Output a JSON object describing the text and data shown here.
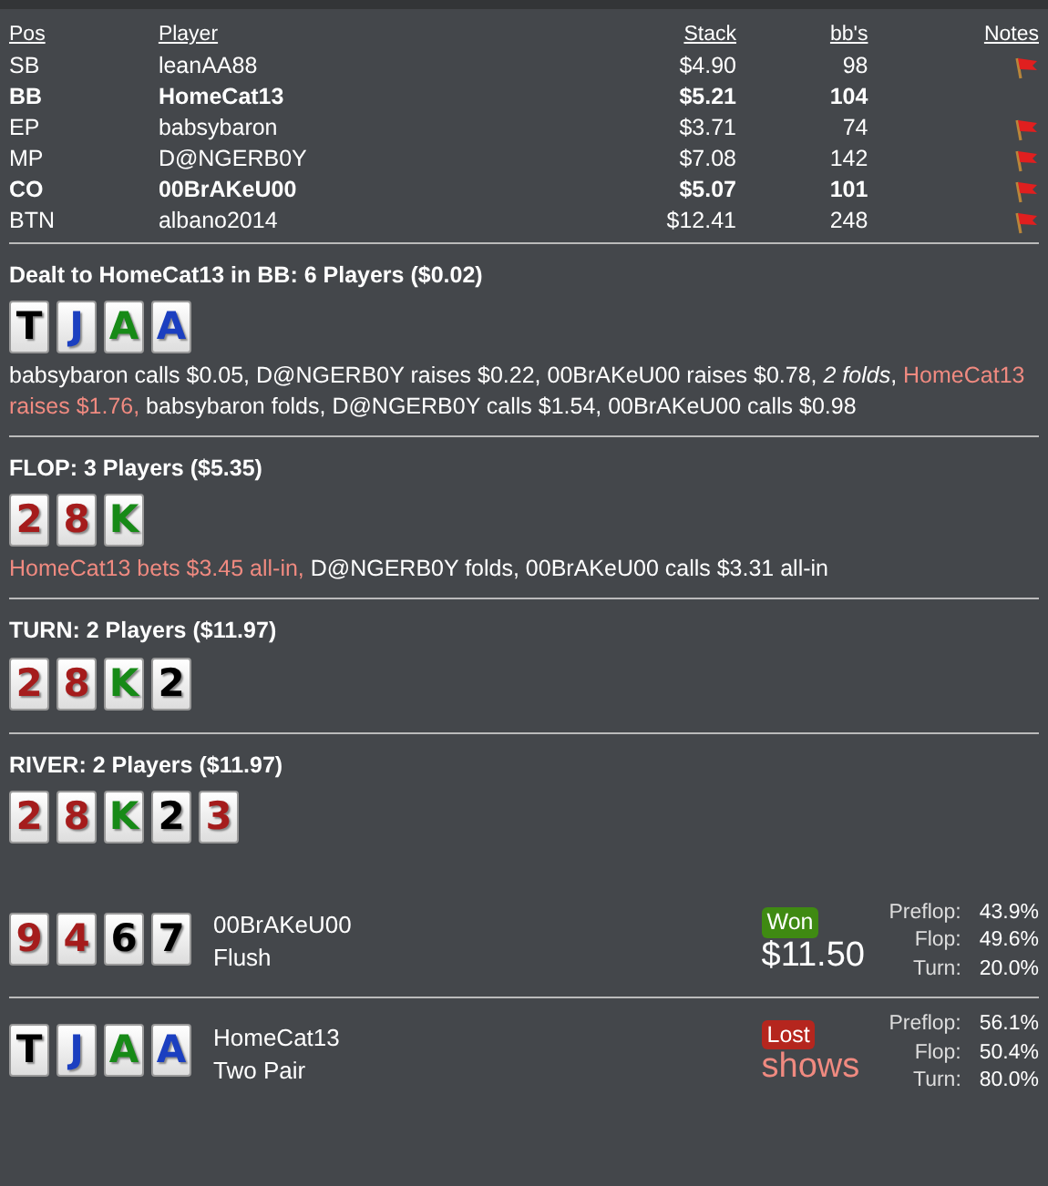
{
  "players": {
    "columns": [
      "Pos",
      "Player",
      "Stack",
      "bb's",
      "Notes"
    ],
    "rows": [
      {
        "pos": "SB",
        "name": "leanAA88",
        "stack": "$4.90",
        "bbs": "98",
        "bold": false,
        "note": true
      },
      {
        "pos": "BB",
        "name": "HomeCat13",
        "stack": "$5.21",
        "bbs": "104",
        "bold": true,
        "note": false
      },
      {
        "pos": "EP",
        "name": "babsybaron",
        "stack": "$3.71",
        "bbs": "74",
        "bold": false,
        "note": true
      },
      {
        "pos": "MP",
        "name": "D@NGERB0Y",
        "stack": "$7.08",
        "bbs": "142",
        "bold": false,
        "note": true
      },
      {
        "pos": "CO",
        "name": "00BrAKeU00",
        "stack": "$5.07",
        "bbs": "101",
        "bold": true,
        "note": true
      },
      {
        "pos": "BTN",
        "name": "albano2014",
        "stack": "$12.41",
        "bbs": "248",
        "bold": false,
        "note": true
      }
    ]
  },
  "streets": [
    {
      "title": "Dealt to HomeCat13 in BB: 6 Players ($0.02)",
      "cards": [
        {
          "rank": "T",
          "color": "#000000"
        },
        {
          "rank": "J",
          "color": "#1b3fc0"
        },
        {
          "rank": "A",
          "color": "#178a17"
        },
        {
          "rank": "A",
          "color": "#1b3fc0"
        }
      ],
      "actions": [
        {
          "text": "babsybaron calls $0.05, D@NGERB0Y raises $0.22, 00BrAKeU00 raises $0.78, ",
          "kind": "plain"
        },
        {
          "text": "2 folds",
          "kind": "italic"
        },
        {
          "text": ", ",
          "kind": "plain"
        },
        {
          "text": "HomeCat13 raises $1.76,",
          "kind": "hero"
        },
        {
          "text": " babsybaron folds, D@NGERB0Y calls $1.54, 00BrAKeU00 calls $0.98",
          "kind": "plain"
        }
      ]
    },
    {
      "title": "FLOP: 3 Players ($5.35)",
      "cards": [
        {
          "rank": "2",
          "color": "#a51c1c"
        },
        {
          "rank": "8",
          "color": "#a51c1c"
        },
        {
          "rank": "K",
          "color": "#178a17"
        }
      ],
      "actions": [
        {
          "text": "HomeCat13 bets $3.45 all-in,",
          "kind": "hero"
        },
        {
          "text": " D@NGERB0Y folds, 00BrAKeU00 calls $3.31 all-in",
          "kind": "plain"
        }
      ]
    },
    {
      "title": "TURN: 2 Players ($11.97)",
      "cards": [
        {
          "rank": "2",
          "color": "#a51c1c"
        },
        {
          "rank": "8",
          "color": "#a51c1c"
        },
        {
          "rank": "K",
          "color": "#178a17"
        },
        {
          "rank": "2",
          "color": "#000000"
        }
      ]
    },
    {
      "title": "RIVER: 2 Players ($11.97)",
      "cards": [
        {
          "rank": "2",
          "color": "#a51c1c"
        },
        {
          "rank": "8",
          "color": "#a51c1c"
        },
        {
          "rank": "K",
          "color": "#178a17"
        },
        {
          "rank": "2",
          "color": "#000000"
        },
        {
          "rank": "3",
          "color": "#a51c1c"
        }
      ]
    }
  ],
  "showdown": [
    {
      "cards": [
        {
          "rank": "9",
          "color": "#a51c1c"
        },
        {
          "rank": "4",
          "color": "#a51c1c"
        },
        {
          "rank": "6",
          "color": "#000000"
        },
        {
          "rank": "7",
          "color": "#000000"
        }
      ],
      "player": "00BrAKeU00",
      "hand": "Flush",
      "result": "Won",
      "kind": "won",
      "amount": "$11.50",
      "equity": [
        {
          "label": "Preflop:",
          "value": "43.9%"
        },
        {
          "label": "Flop:",
          "value": "49.6%"
        },
        {
          "label": "Turn:",
          "value": "20.0%"
        }
      ]
    },
    {
      "cards": [
        {
          "rank": "T",
          "color": "#000000"
        },
        {
          "rank": "J",
          "color": "#1b3fc0"
        },
        {
          "rank": "A",
          "color": "#178a17"
        },
        {
          "rank": "A",
          "color": "#1b3fc0"
        }
      ],
      "player": "HomeCat13",
      "hand": "Two Pair",
      "result": "Lost",
      "kind": "lost",
      "amount": "shows",
      "equity": [
        {
          "label": "Preflop:",
          "value": "56.1%"
        },
        {
          "label": "Flop:",
          "value": "50.4%"
        },
        {
          "label": "Turn:",
          "value": "80.0%"
        }
      ]
    }
  ]
}
